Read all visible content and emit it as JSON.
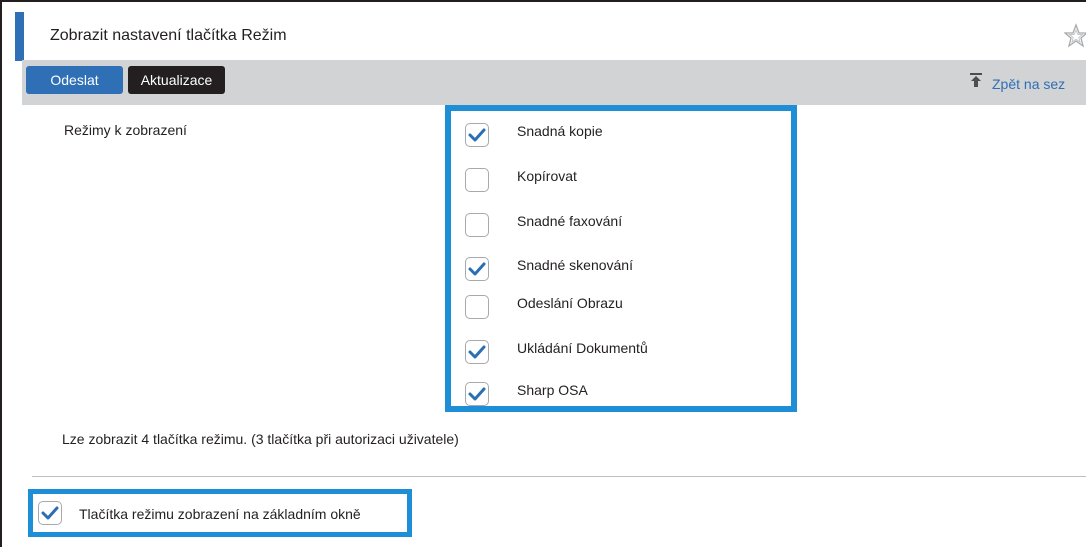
{
  "header": {
    "title": "Zobrazit nastavení tlačítka Režim"
  },
  "toolbar": {
    "send_label": "Odeslat",
    "update_label": "Aktualizace",
    "back_link": "Zpět na sez"
  },
  "modes": {
    "label": "Režimy k zobrazení",
    "items": [
      {
        "label": "Snadná kopie",
        "checked": true
      },
      {
        "label": "Kopírovat",
        "checked": false
      },
      {
        "label": "Snadné faxování",
        "checked": false
      },
      {
        "label": "Snadné skenování",
        "checked": true
      },
      {
        "label": "Odeslání Obrazu",
        "checked": false
      },
      {
        "label": "Ukládání Dokumentů",
        "checked": true
      },
      {
        "label": "Sharp OSA",
        "checked": true
      }
    ]
  },
  "note": "Lze zobrazit 4 tlačítka režimu. (3 tlačítka při autorizaci uživatele)",
  "home_option": {
    "label": "Tlačítka režimu zobrazení na základním okně",
    "checked": true
  },
  "colors": {
    "accent": "#2f6fb5",
    "highlight": "#1e8fd6",
    "check": "#2a6fb3",
    "toolbar": "#d2d3d5"
  }
}
